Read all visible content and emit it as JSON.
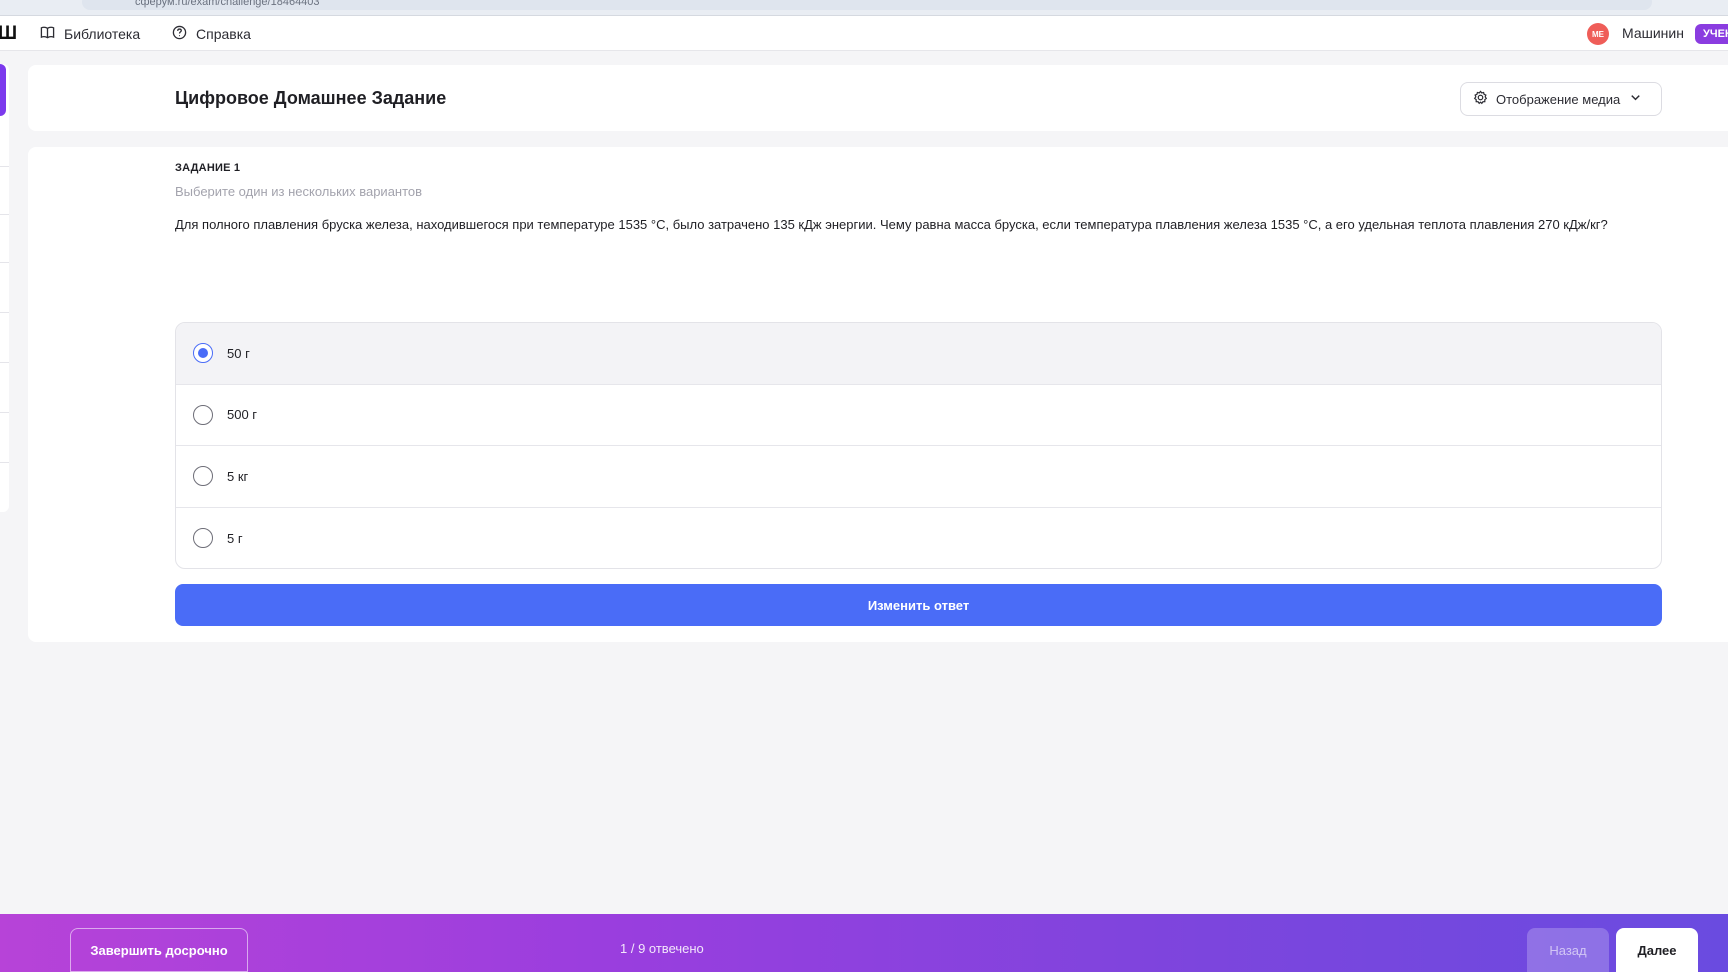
{
  "browser": {
    "url": "сферум.ru/exam/challenge/18464403"
  },
  "topnav": {
    "logo_letter": "Ш",
    "library_label": "Библиотека",
    "help_label": "Справка",
    "avatar_initials": "МЕ",
    "user_name": "Машинин",
    "role_badge": "УЧЕН"
  },
  "header": {
    "title": "Цифровое Домашнее Задание",
    "media_button_label": "Отображение медиа"
  },
  "task": {
    "number_label": "ЗАДАНИЕ 1",
    "hint": "Выберите один из нескольких вариантов",
    "question": "Для полного плавления бруска железа, находившегося при температуре 1535 °C, было затрачено 135 кДж энергии. Чему равна масса бруска, если температура плавления железа 1535 °C, а его удельная теплота плавления 270 кДж/кг?",
    "options": [
      {
        "label": "50 г",
        "selected": true
      },
      {
        "label": "500 г",
        "selected": false
      },
      {
        "label": "5 кг",
        "selected": false
      },
      {
        "label": "5 г",
        "selected": false
      }
    ],
    "change_answer_label": "Изменить ответ"
  },
  "footer": {
    "finish_label": "Завершить досрочно",
    "progress_text": "1 / 9 отвечено",
    "back_label": "Назад",
    "next_label": "Далее"
  },
  "colors": {
    "accent": "#4a6cf7",
    "footer_gradient_start": "#b743d8",
    "footer_gradient_end": "#6a4be0",
    "avatar_bg": "#ef5d58",
    "role_badge_bg": "#8a3ce0"
  },
  "icons": {
    "library": "book-icon",
    "help": "question-circle-icon",
    "media": "gear-icon",
    "media_dropdown": "chevron-down-icon"
  }
}
